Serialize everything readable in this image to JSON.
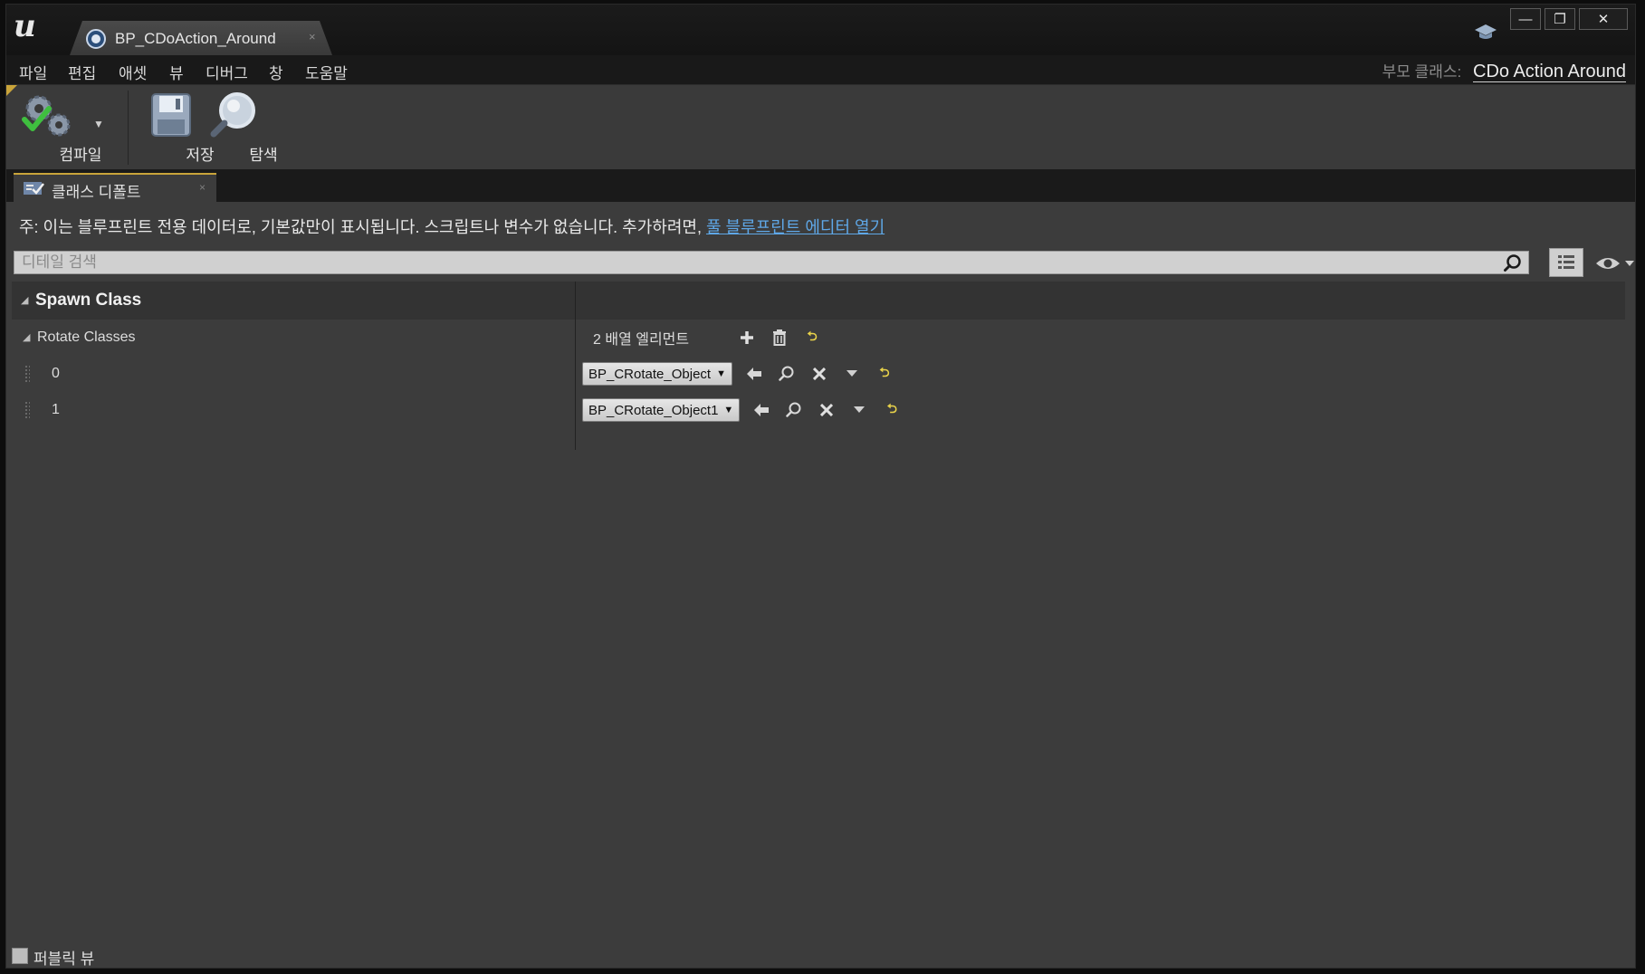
{
  "window": {
    "tab_title": "BP_CDoAction_Around",
    "tab_close": "×",
    "minimize": "—",
    "maximize": "❐",
    "close": "✕"
  },
  "menu": {
    "items": [
      "파일",
      "편집",
      "애셋",
      "뷰",
      "디버그",
      "창",
      "도움말"
    ],
    "parent_label": "부모 클래스:",
    "parent_value": "CDo Action Around"
  },
  "toolbar": {
    "compile": "컴파일",
    "save": "저장",
    "browse": "탐색"
  },
  "panel": {
    "tab_label": "클래스 디폴트",
    "tab_close": "×",
    "notice_text": "주: 이는 블루프린트 전용 데이터로, 기본값만이 표시됩니다. 스크립트나 변수가 없습니다. 추가하려면, ",
    "notice_link": "풀 블루프린트 에디터 열기",
    "search_placeholder": "디테일 검색"
  },
  "details": {
    "category": "Spawn Class",
    "property": "Rotate Classes",
    "array_count": "2 배열 엘리먼트",
    "elements": [
      {
        "index": "0",
        "value": "BP_CRotate_Object"
      },
      {
        "index": "1",
        "value": "BP_CRotate_Object1"
      }
    ]
  },
  "footer": {
    "public_view": "퍼블릭 뷰"
  },
  "colors": {
    "background": "#3c3c3c",
    "titlebar": "#141414",
    "link": "#5fa8e8",
    "accent": "#c9a43a",
    "reset": "#e8d24a"
  }
}
